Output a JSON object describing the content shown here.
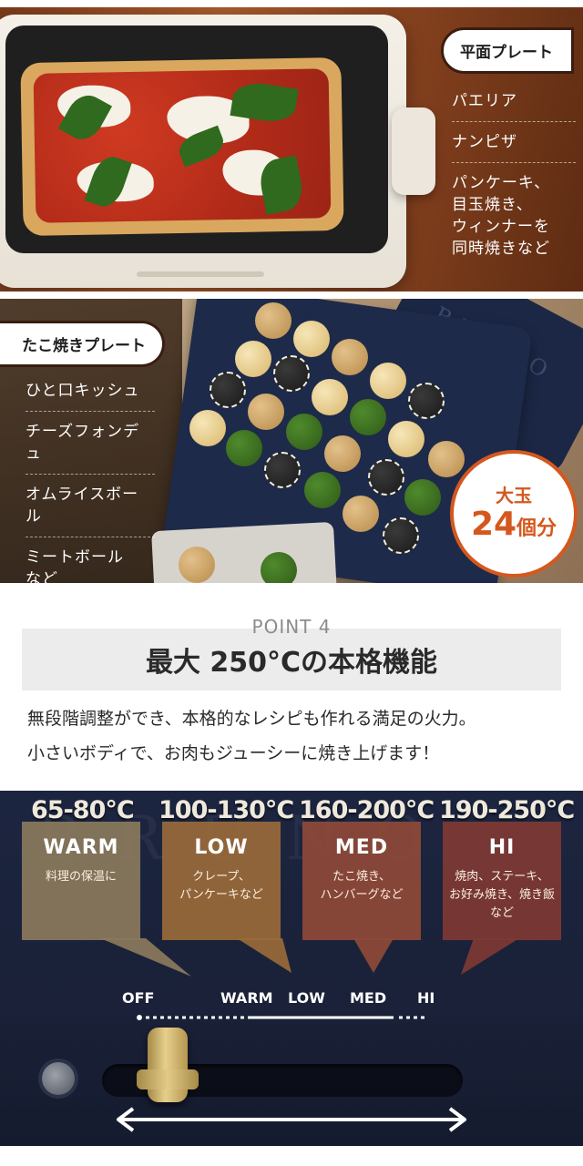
{
  "flat_plate": {
    "title": "平面プレート",
    "items": [
      "パエリア",
      "ナンピザ",
      "パンケーキ、\n目玉焼き、\nウィンナーを\n同時焼きなど"
    ]
  },
  "takoyaki_plate": {
    "title": "たこ焼きプレート",
    "items": [
      "ひと口キッシュ",
      "チーズフォンデュ",
      "オムライスボール",
      "ミートボール\nなど"
    ],
    "badge_top": "大玉",
    "badge_count": "24",
    "badge_unit": "個分",
    "lid_brand": "BRUNO"
  },
  "point": {
    "label": "POINT 4",
    "title": "最大 250°Cの本格機能",
    "description_lines": [
      "無段階調整ができ、本格的なレシピも作れる満足の火力。",
      "小さいボディで、お肉もジューシーに焼き上げます！"
    ]
  },
  "levels": [
    {
      "temp": "65-80°C",
      "name": "WARM",
      "desc": "料理の保温に",
      "color": "#8a7a5c"
    },
    {
      "temp": "100-130°C",
      "name": "LOW",
      "desc": "クレープ、\nパンケーキなど",
      "color": "#9a6a3a"
    },
    {
      "temp": "160-200°C",
      "name": "MED",
      "desc": "たこ焼き、\nハンバーグなど",
      "color": "#8e4a38"
    },
    {
      "temp": "190-250°C",
      "name": "HI",
      "desc": "焼肉、ステーキ、\nお好み焼き、焼き飯\nなど",
      "color": "#7e3a34"
    }
  ],
  "dial": {
    "labels": [
      "OFF",
      "WARM",
      "LOW",
      "MED",
      "HI"
    ],
    "brand_ghost": "BRUNO"
  }
}
